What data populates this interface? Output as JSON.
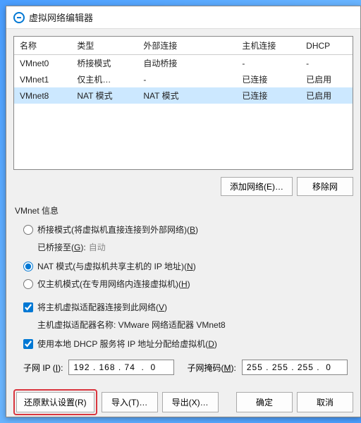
{
  "titlebar": {
    "title": "虚拟网络编辑器"
  },
  "table": {
    "headers": {
      "name": "名称",
      "type": "类型",
      "ext": "外部连接",
      "host": "主机连接",
      "dhcp": "DHCP"
    },
    "rows": [
      {
        "name": "VMnet0",
        "type": "桥接模式",
        "ext": "自动桥接",
        "host": "-",
        "dhcp": "-"
      },
      {
        "name": "VMnet1",
        "type": "仅主机…",
        "ext": "-",
        "host": "已连接",
        "dhcp": "已启用"
      },
      {
        "name": "VMnet8",
        "type": "NAT 模式",
        "ext": "NAT 模式",
        "host": "已连接",
        "dhcp": "已启用"
      }
    ]
  },
  "btns": {
    "addNet": "添加网络(E)…",
    "removeNet": "移除网",
    "restore": "还原默认设置(R)",
    "import": "导入(T)…",
    "export": "导出(X)…",
    "ok": "确定",
    "cancel": "取消"
  },
  "group": {
    "title": "VMnet 信息"
  },
  "radios": {
    "bridge": "桥接模式(将虚拟机直接连接到外部网络)(",
    "bridge_u": "B",
    "bridge_end": ")",
    "bridgeToLabel": "已桥接至(",
    "bridgeTo_u": "G",
    "bridgeTo_end": "):",
    "bridgeToVal": "自动",
    "nat": "NAT 模式(与虚拟机共享主机的 IP 地址)(",
    "nat_u": "N",
    "nat_end": ")",
    "hostonly": "仅主机模式(在专用网络内连接虚拟机)(",
    "hostonly_u": "H",
    "hostonly_end": ")"
  },
  "checks": {
    "hostAdapter": "将主机虚拟适配器连接到此网络(",
    "hostAdapter_u": "V",
    "hostAdapter_end": ")",
    "hostAdapterInfo": "主机虚拟适配器名称: VMware 网络适配器 VMnet8",
    "dhcp": "使用本地 DHCP 服务将 IP 地址分配给虚拟机(",
    "dhcp_u": "D",
    "dhcp_end": ")"
  },
  "ip": {
    "subnetLabel": "子网 IP (",
    "subnet_u": "I",
    "subnet_end": "):",
    "subnetVal": "192 . 168 . 74  .  0",
    "maskLabel": "子网掩码(",
    "mask_u": "M",
    "mask_end": "):",
    "maskVal": "255 . 255 . 255 .  0"
  }
}
